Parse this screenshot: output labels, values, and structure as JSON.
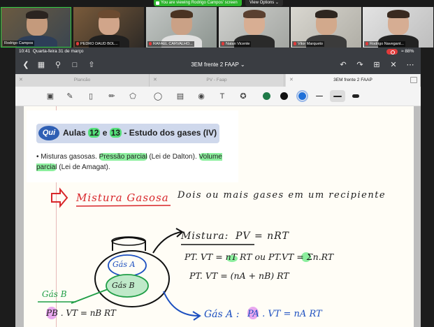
{
  "zoom": {
    "banner": "You are viewing Rodrigo Campos' screen",
    "view_options": "View Options ⌄",
    "participants": [
      {
        "name": "Rodrigo Campos",
        "muted": false
      },
      {
        "name": "PEDRO DAUD BOL...",
        "muted": true
      },
      {
        "name": "RAFAEL CARVALHO...",
        "muted": true
      },
      {
        "name": "Natan Vicente",
        "muted": true
      },
      {
        "name": "Vitor Marqueto",
        "muted": true
      },
      {
        "name": "Rodrigo Navegant...",
        "muted": true
      }
    ]
  },
  "status": {
    "time": "10:41",
    "date": "Quarta-feira 31 de março",
    "battery": "88%"
  },
  "app": {
    "document_title": "3EM frente 2 FAAP ⌄",
    "tabs": [
      {
        "label": "Plancão",
        "active": false
      },
      {
        "label": "PV - Faap",
        "active": false
      },
      {
        "label": "3EM frente 2 FAAP",
        "active": true
      }
    ],
    "colors": {
      "green": "#1f7a48",
      "black": "#111111",
      "blue": "#1f6fd8"
    }
  },
  "slide": {
    "badge": "Qui",
    "title_prefix": "Aulas ",
    "title_n1": "12",
    "title_and": " e ",
    "title_n2": "13",
    "title_suffix": " - Estudo dos gases (IV)",
    "bullet_1": "• Misturas gasosas. ",
    "bullet_hl1": "Pressão parcial",
    "bullet_2": " (Lei de Dalton). ",
    "bullet_hl2": "Volume parcial",
    "bullet_3": " (Lei de Amagat)."
  },
  "notes": {
    "heading": "Mistura Gasosa",
    "heading_desc": "Dois ou mais gases em um recipiente",
    "mix_label": "Mistura:",
    "eq_pv": "PV = nRT",
    "eq_line1": "PT. VT = nT RT   ou   PT.VT = Σn.RT",
    "eq_line2": "PT. VT = (nA + nB) RT",
    "gas_a": "Gás A",
    "gas_b": "Gás B",
    "gas_b_side": "Gás B",
    "eq_b": "PB . VT = nB RT",
    "gas_a_eq_label": "Gás A :",
    "eq_a": "PA . VT = nA RT"
  }
}
